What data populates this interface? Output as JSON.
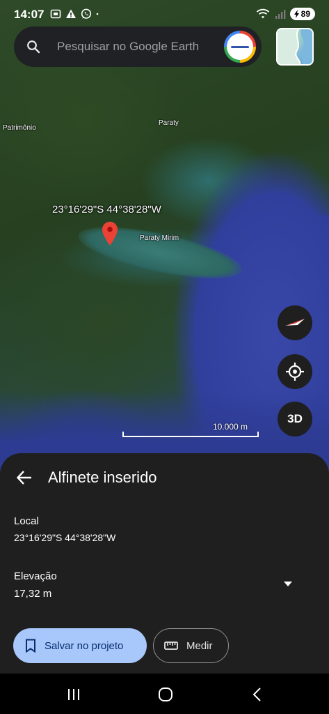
{
  "status_bar": {
    "time": "14:07",
    "battery": "89"
  },
  "search": {
    "placeholder": "Pesquisar no Google Earth"
  },
  "map": {
    "labels": {
      "patrimonio": "Patrimônio",
      "paraty": "Paraty",
      "paraty_mirim": "Paraty Mirim"
    },
    "pin_coordinates": "23°16'29\"S 44°38'28\"W",
    "scale": "10.000 m"
  },
  "controls": {
    "three_d": "3D"
  },
  "sheet": {
    "title": "Alfinete inserido",
    "local_label": "Local",
    "local_value": "23°16'29\"S 44°38'28\"W",
    "elevation_label": "Elevação",
    "elevation_value": "17,32 m",
    "save_button": "Salvar no projeto",
    "measure_button": "Medir"
  },
  "colors": {
    "accent": "#a8c7fa",
    "sheet_bg": "#1f1f1f",
    "pin": "#ea4335"
  }
}
